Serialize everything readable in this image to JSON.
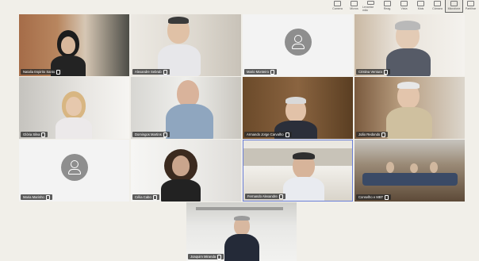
{
  "toolbar": {
    "buttons": [
      {
        "label": "Camera"
      },
      {
        "label": "Micros"
      },
      {
        "label": "Levantar mão"
      },
      {
        "label": "Reag."
      },
      {
        "label": "Vista"
      },
      {
        "label": "Mais"
      },
      {
        "label": "Câmara"
      },
      {
        "label": "Microfone"
      },
      {
        "label": "Partilhar"
      }
    ]
  },
  "participants": [
    {
      "name": "Natalia Espirito Santo",
      "type": "video"
    },
    {
      "name": "Alexandre Sebrab",
      "type": "video"
    },
    {
      "name": "Mario Monteiro",
      "type": "avatar"
    },
    {
      "name": "Cristina Ventura",
      "type": "video"
    },
    {
      "name": "Glória Silva",
      "type": "video"
    },
    {
      "name": "Domingos Martins",
      "type": "video"
    },
    {
      "name": "Armando Jorge Carvalho",
      "type": "video"
    },
    {
      "name": "João Redondo",
      "type": "video"
    },
    {
      "name": "Maria Marinho",
      "type": "avatar"
    },
    {
      "name": "Célia Cabo",
      "type": "video"
    },
    {
      "name": "Fernando Alexandre",
      "type": "video",
      "active": true
    },
    {
      "name": "Conselho e MBT",
      "type": "video"
    },
    {
      "name": "Joaquim Miranda",
      "type": "video"
    }
  ]
}
